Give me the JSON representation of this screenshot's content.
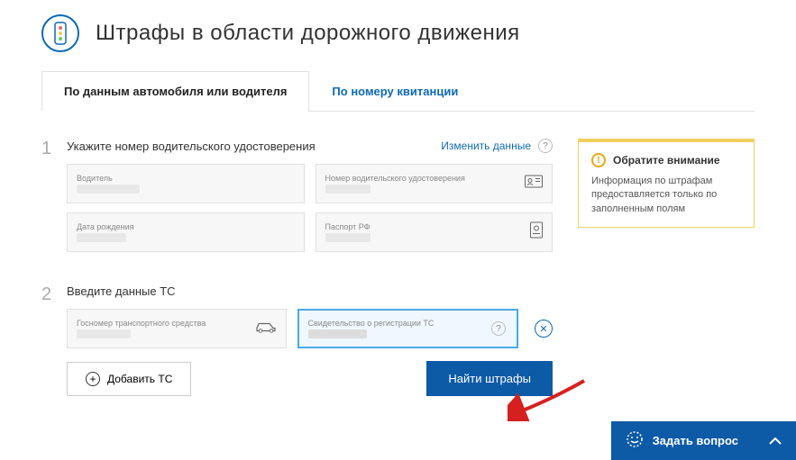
{
  "header": {
    "title": "Штрафы в области дорожного движения"
  },
  "tabs": {
    "vehicle": "По данным автомобиля или водителя",
    "receipt": "По номеру квитанции"
  },
  "step1": {
    "num": "1",
    "title": "Укажите номер водительского удостоверения",
    "change_link": "Изменить данные",
    "driver_label": "Водитель",
    "license_label": "Номер водительского удостоверения",
    "dob_label": "Дата рождения",
    "passport_label": "Паспорт РФ"
  },
  "step2": {
    "num": "2",
    "title": "Введите данные ТС",
    "plate_label": "Госномер транспортного средства",
    "cert_label": "Свидетельство о регистрации ТС",
    "add_btn": "Добавить ТС",
    "search_btn": "Найти штрафы"
  },
  "notice": {
    "title": "Обратите внимание",
    "text": "Информация по штрафам предоставляется только по заполненным полям"
  },
  "ask": {
    "label": "Задать вопрос"
  },
  "help": "?",
  "close": "✕"
}
